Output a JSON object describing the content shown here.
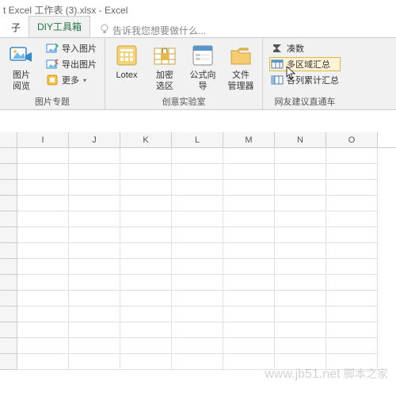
{
  "title": "t Excel 工作表 (3).xlsx - Excel",
  "tabs": {
    "left": "子",
    "active": "DIY工具箱"
  },
  "tellme": "告诉我您想要做什么...",
  "ribbon": {
    "g1": {
      "view": "图片\n阅览",
      "import": "导入图片",
      "export": "导出图片",
      "more": "更多",
      "label": "图片专题"
    },
    "g2": {
      "lotex": "Lotex",
      "sel": "加密\n选区",
      "wiz": "公式向\n导",
      "file": "文件\n管理器",
      "label": "创意实验室"
    },
    "g3": {
      "cou": "凑数",
      "multi": "多区域汇总",
      "cols": "各列累计汇总",
      "label": "网友建议直通车"
    }
  },
  "columns": [
    "I",
    "J",
    "K",
    "L",
    "M",
    "N",
    "O"
  ],
  "watermark": {
    "url": "www.jb51.net",
    "cn": "脚本之家"
  }
}
